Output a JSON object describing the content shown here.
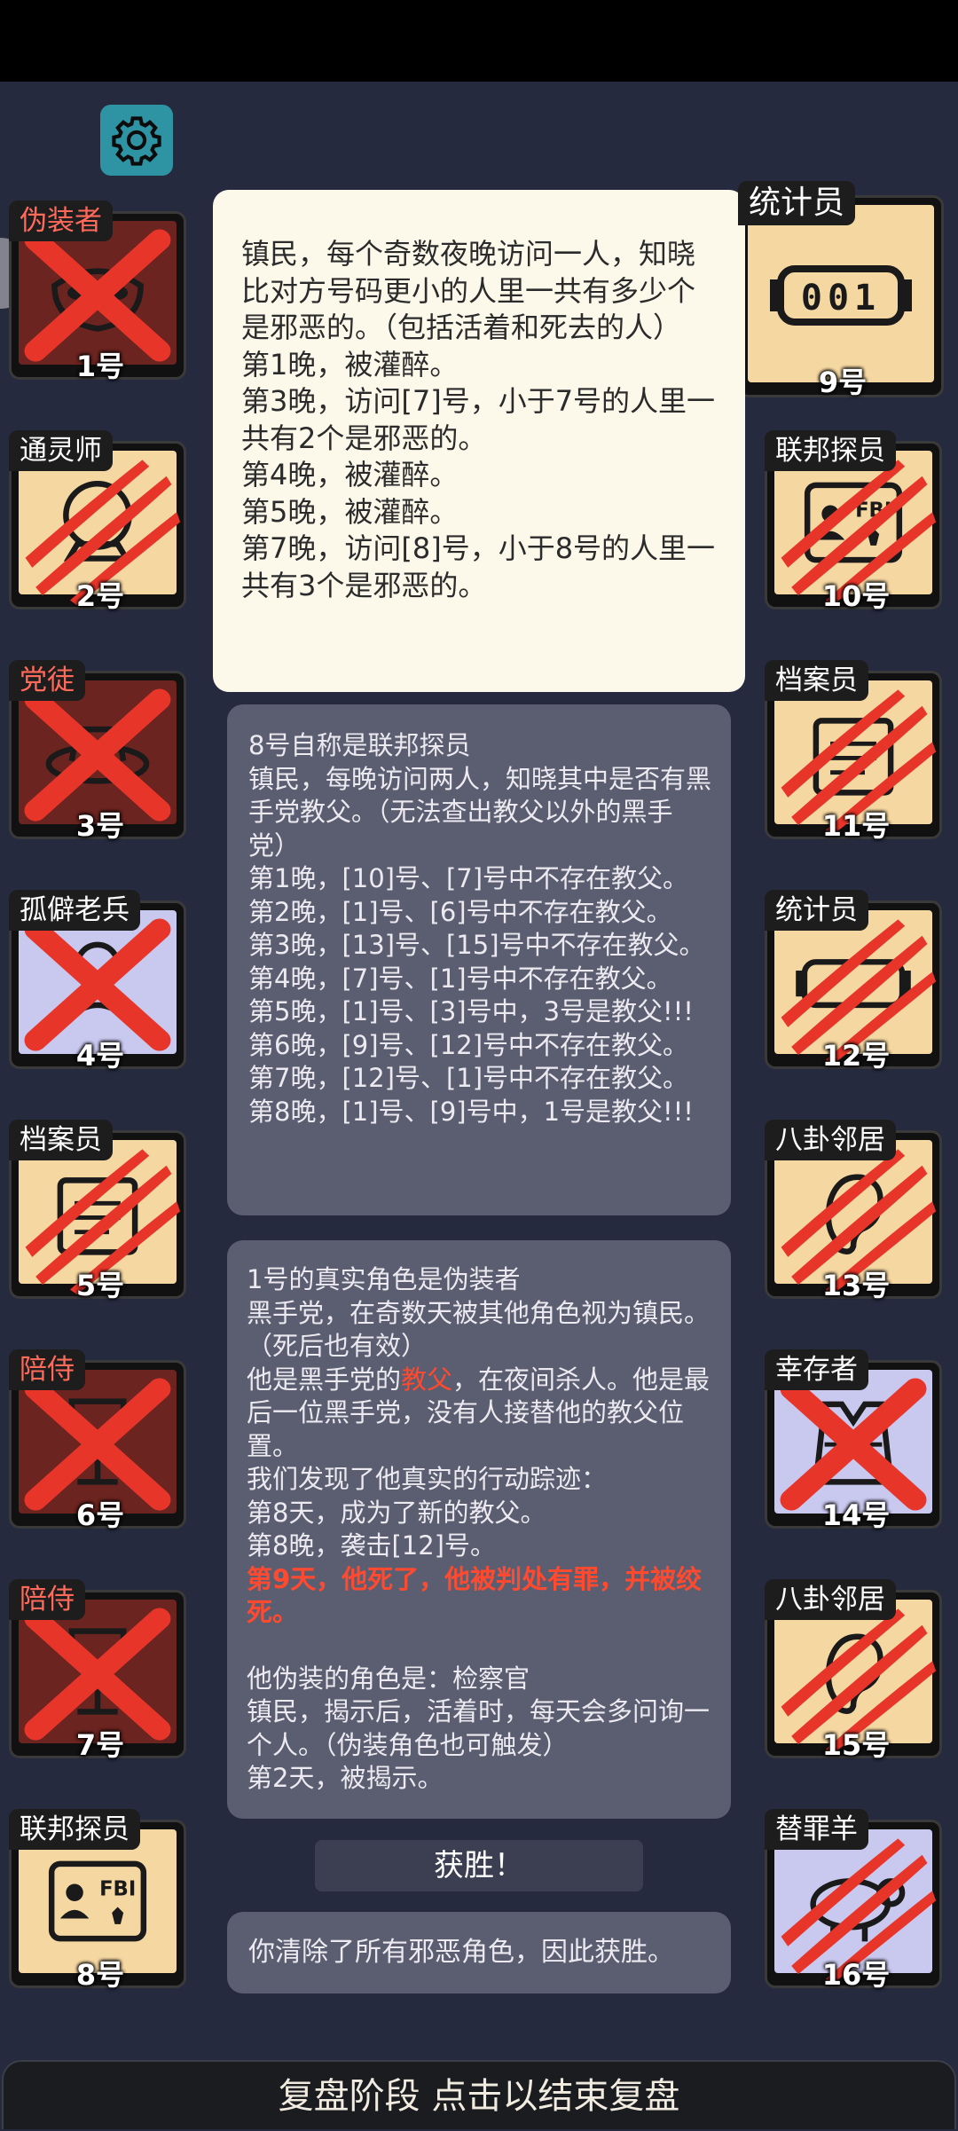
{
  "header": {
    "settings_icon": "gear-icon"
  },
  "colors": {
    "town": "#f5d7a1",
    "evil": "#6b2420",
    "outsider": "#c9c8ee",
    "kill_mark": "#e8352a"
  },
  "left_cards": [
    {
      "role": "伪装者",
      "num": "1号",
      "team": "evil",
      "mark": "x",
      "icon": "mask-icon"
    },
    {
      "role": "通灵师",
      "num": "2号",
      "team": "town",
      "mark": "claw",
      "icon": "crystal-ball-icon"
    },
    {
      "role": "党徒",
      "num": "3号",
      "team": "evil",
      "mark": "x",
      "icon": "hat-icon"
    },
    {
      "role": "孤僻老兵",
      "num": "4号",
      "team": "outsider",
      "mark": "x",
      "icon": "veteran-icon"
    },
    {
      "role": "档案员",
      "num": "5号",
      "team": "town",
      "mark": "claw",
      "icon": "folder-icon"
    },
    {
      "role": "陪侍",
      "num": "6号",
      "team": "evil",
      "mark": "x",
      "icon": "wine-glass-icon"
    },
    {
      "role": "陪侍",
      "num": "7号",
      "team": "evil",
      "mark": "x",
      "icon": "wine-glass-icon"
    },
    {
      "role": "联邦探员",
      "num": "8号",
      "team": "town",
      "mark": "none",
      "icon": "fbi-badge-icon"
    }
  ],
  "right_cards": [
    {
      "role": "统计员",
      "num": "9号",
      "team": "town",
      "mark": "none",
      "icon": "counter-icon",
      "counter": "001"
    },
    {
      "role": "联邦探员",
      "num": "10号",
      "team": "town",
      "mark": "claw",
      "icon": "fbi-badge-icon"
    },
    {
      "role": "档案员",
      "num": "11号",
      "team": "town",
      "mark": "claw",
      "icon": "folder-icon"
    },
    {
      "role": "统计员",
      "num": "12号",
      "team": "town",
      "mark": "claw",
      "icon": "counter-icon"
    },
    {
      "role": "八卦邻居",
      "num": "13号",
      "team": "town",
      "mark": "claw",
      "icon": "ear-icon"
    },
    {
      "role": "幸存者",
      "num": "14号",
      "team": "outsider",
      "mark": "x",
      "icon": "vest-icon"
    },
    {
      "role": "八卦邻居",
      "num": "15号",
      "team": "town",
      "mark": "claw",
      "icon": "ear-icon"
    },
    {
      "role": "替罪羊",
      "num": "16号",
      "team": "outsider",
      "mark": "claw",
      "icon": "sheep-icon"
    }
  ],
  "panel_1": {
    "text": "镇民，每个奇数夜晚访问一人，知晓比对方号码更小的人里一共有多少个是邪恶的。（包括活着和死去的人）\n第1晚，被灌醉。\n第3晚，访问[7]号，小于7号的人里一共有2个是邪恶的。\n第4晚，被灌醉。\n第5晚，被灌醉。\n第7晚，访问[8]号，小于8号的人里一共有3个是邪恶的。"
  },
  "panel_2": {
    "text": "8号自称是联邦探员\n镇民，每晚访问两人，知晓其中是否有黑手党教父。（无法查出教父以外的黑手党）\n第1晚，[10]号、[7]号中不存在教父。\n第2晚，[1]号、[6]号中不存在教父。\n第3晚，[13]号、[15]号中不存在教父。\n第4晚，[7]号、[1]号中不存在教父。\n第5晚，[1]号、[3]号中，3号是教父!!!\n第6晚，[9]号、[12]号中不存在教父。\n第7晚，[12]号、[1]号中不存在教父。\n第8晚，[1]号、[9]号中，1号是教父!!!"
  },
  "panel_3": {
    "line1": "1号的真实角色是伪装者",
    "line2": "黑手党，在奇数天被其他角色视为镇民。（死后也有效）",
    "line3_pre": "他是黑手党的",
    "line3_red": "教父",
    "line3_post": "，在夜间杀人。他是最后一位黑手党，没有人接替他的教父位置。",
    "line4": "我们发现了他真实的行动踪迹：\n第8天，成为了新的教父。\n第8晚，袭击[12]号。",
    "line5_red": "第9天，他死了，他被判处有罪，并被绞死。",
    "line6": "他伪装的角色是：检察官\n镇民，揭示后，活着时，每天会多问询一个人。（伪装角色也可触发）\n第2天，被揭示。"
  },
  "win": {
    "label": "获胜！"
  },
  "panel_4": {
    "text": "你清除了所有邪恶角色，因此获胜。"
  },
  "footer": {
    "label": "复盘阶段 点击以结束复盘"
  }
}
